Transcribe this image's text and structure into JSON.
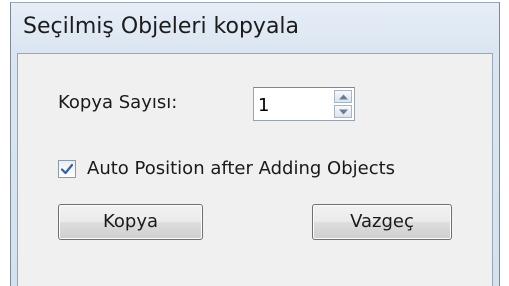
{
  "window": {
    "title": "Seçilmiş Objeleri kopyala"
  },
  "form": {
    "copy_count_label": "Kopya Sayısı:",
    "copy_count_value": "1",
    "auto_position_label": "Auto Position after Adding Objects",
    "auto_position_checked": true
  },
  "buttons": {
    "copy_label": "Kopya",
    "cancel_label": "Vazgeç"
  },
  "icons": {
    "spin_up": "arrow-up-icon",
    "spin_down": "arrow-down-icon",
    "check": "checkmark-icon"
  },
  "colors": {
    "title_bar": "#dbe5f1",
    "client_bg": "#f0f0f0",
    "check_blue": "#3a5f9e"
  }
}
